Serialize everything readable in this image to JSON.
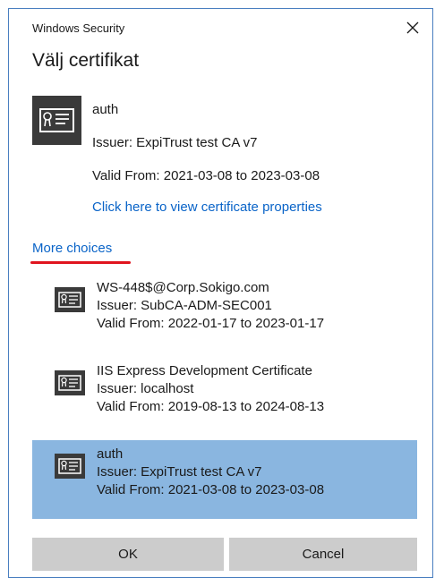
{
  "window": {
    "app_title": "Windows Security",
    "close_glyph": "✕"
  },
  "heading": "Välj certifikat",
  "selected_certificate": {
    "name": "auth",
    "issuer": "Issuer: ExpiTrust test CA v7",
    "valid": "Valid From: 2021-03-08 to 2023-03-08",
    "properties_link": "Click here to view certificate properties",
    "icon": "certificate-icon"
  },
  "more_choices_label": "More choices",
  "choices": [
    {
      "name": "WS-448$@Corp.Sokigo.com",
      "issuer": "Issuer: SubCA-ADM-SEC001",
      "valid": "Valid From: 2022-01-17 to 2023-01-17",
      "selected": false,
      "icon": "certificate-icon"
    },
    {
      "name": "IIS Express Development Certificate",
      "issuer": "Issuer: localhost",
      "valid": "Valid From: 2019-08-13 to 2024-08-13",
      "selected": false,
      "icon": "certificate-icon"
    },
    {
      "name": "auth",
      "issuer": "Issuer: ExpiTrust test CA v7",
      "valid": "Valid From: 2021-03-08 to 2023-03-08",
      "selected": true,
      "icon": "certificate-icon"
    }
  ],
  "buttons": {
    "ok": "OK",
    "cancel": "Cancel"
  },
  "colors": {
    "link": "#0a64c8",
    "selected_row": "#8ab6e0",
    "button_bg": "#cccccc",
    "annotation_underline": "#e0141e",
    "window_border": "#4a7fc0"
  }
}
